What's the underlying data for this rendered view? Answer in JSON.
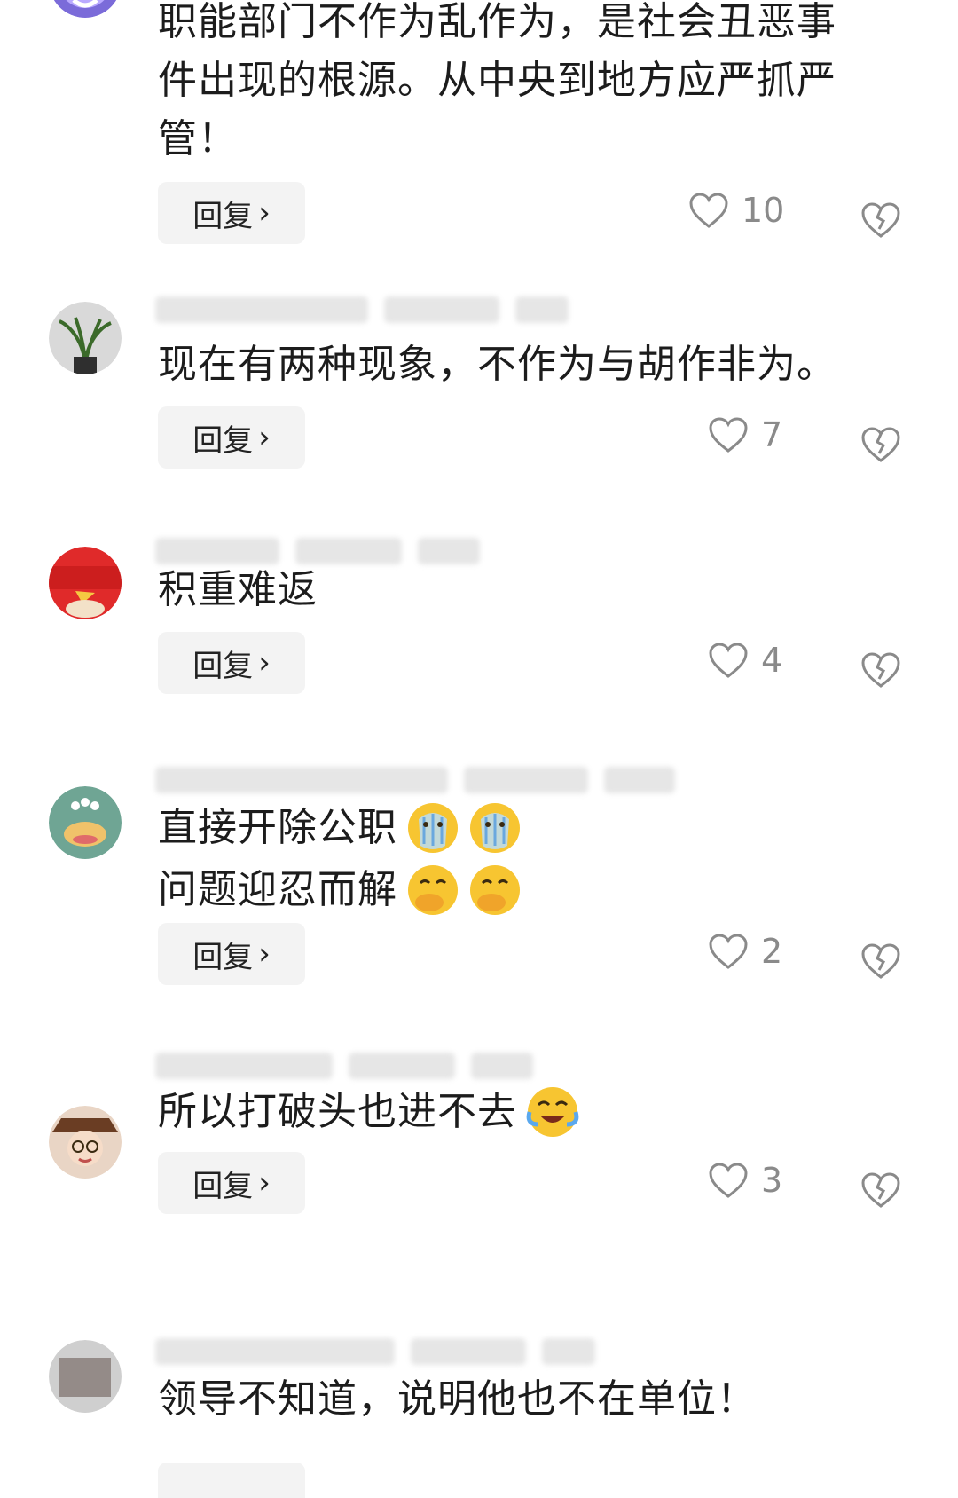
{
  "reply_label": "回复",
  "reply_chevron": "›",
  "comments": [
    {
      "lines": [
        "职能部门不作为乱作为，是社会丑恶事",
        "件出现的根源。从中央到地方应严抓严",
        "管！"
      ],
      "likes": "10",
      "avatar_icon": "purple-avatar-icon"
    },
    {
      "lines": [
        "现在有两种现象，不作为与胡作非为。"
      ],
      "likes": "7",
      "avatar_icon": "plant-avatar-icon"
    },
    {
      "lines": [
        "积重难返"
      ],
      "likes": "4",
      "avatar_icon": "red-bird-avatar-icon"
    },
    {
      "lines": [
        "直接开除公职",
        "问题迎忍而解"
      ],
      "emojis": [
        [
          "crying-emoji",
          "crying-emoji"
        ],
        [
          "hand-over-mouth-emoji",
          "hand-over-mouth-emoji"
        ]
      ],
      "likes": "2",
      "avatar_icon": "monster-avatar-icon"
    },
    {
      "lines": [
        "所以打破头也进不去"
      ],
      "emojis": [
        [
          "laughing-crying-emoji"
        ]
      ],
      "likes": "3",
      "avatar_icon": "girl-avatar-icon"
    },
    {
      "lines": [
        "领导不知道，说明他也不在单位！"
      ],
      "avatar_icon": "blurred-avatar-icon"
    }
  ],
  "colors": {
    "reply_bg": "#f3f3f3",
    "icon_gray": "#8a8a8a",
    "text": "#1c1c1c"
  }
}
